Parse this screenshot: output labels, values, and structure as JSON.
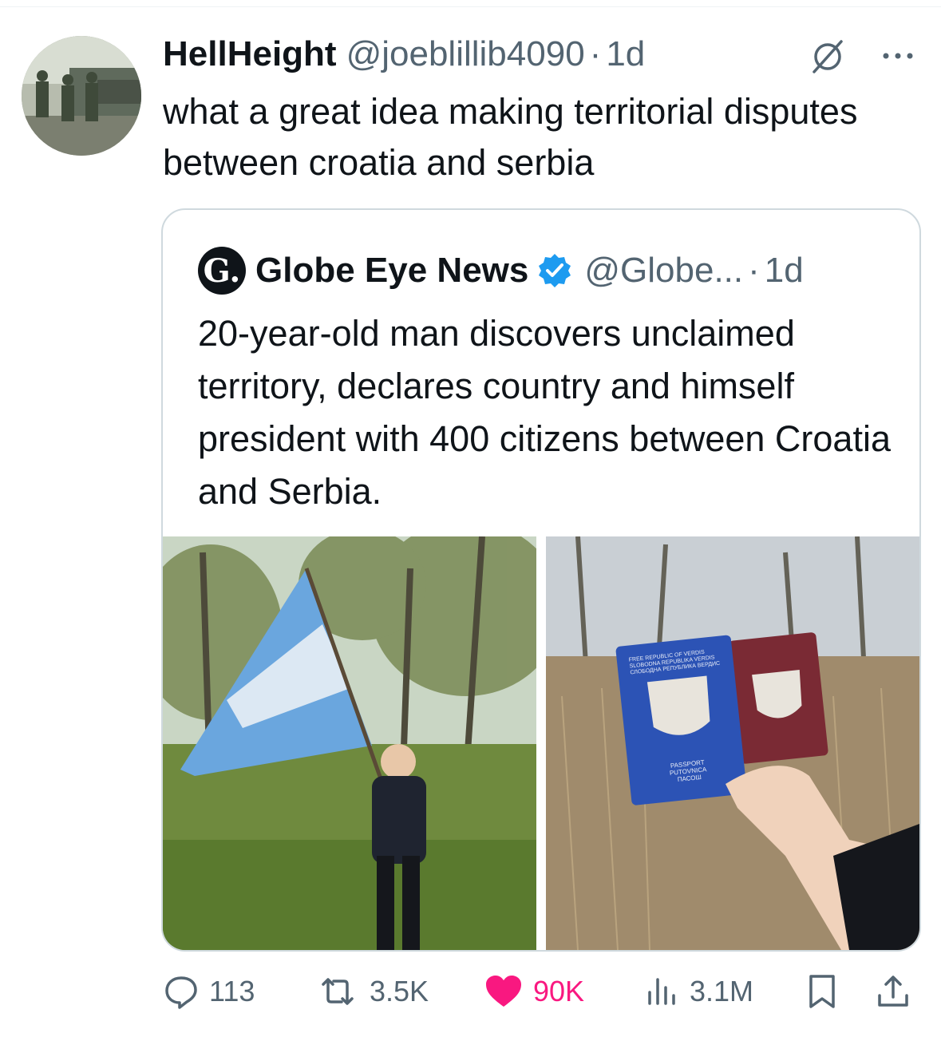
{
  "tweet": {
    "display_name": "HellHeight",
    "handle": "@joeblillib4090",
    "separator": "·",
    "time": "1d",
    "text": "what a great idea making territorial disputes between croatia and serbia",
    "avatar_icon": "avatar-photo-soldiers",
    "muted_icon": "muted-conversation-icon",
    "more_icon": "more-options-icon"
  },
  "quote": {
    "avatar_letter": "G.",
    "display_name": "Globe Eye News",
    "verified": true,
    "handle": "@Globe...",
    "separator": "·",
    "time": "1d",
    "text": "20-year-old man discovers unclaimed territory, declares country and himself president with 400 citizens between Croatia and Serbia.",
    "images": [
      {
        "description": "man-with-flag-photo"
      },
      {
        "description": "passports-photo",
        "passport_lines": [
          "FREE REPUBLIC OF VERDIS",
          "SLOBODNA REPUBLIKA VERDIS",
          "СЛОБОДНА РЕПУБЛИКА ВЕРДИС"
        ],
        "passport_bottom": [
          "PASSPORT",
          "PUTOVNICA",
          "ПАСОШ"
        ]
      }
    ]
  },
  "actions": {
    "replies": "113",
    "reposts": "3.5K",
    "likes": "90K",
    "views": "3.1M"
  },
  "colors": {
    "text": "#0f1419",
    "secondary": "#536471",
    "like": "#f91880",
    "verified": "#1d9bf0",
    "border": "#cfd9de"
  }
}
